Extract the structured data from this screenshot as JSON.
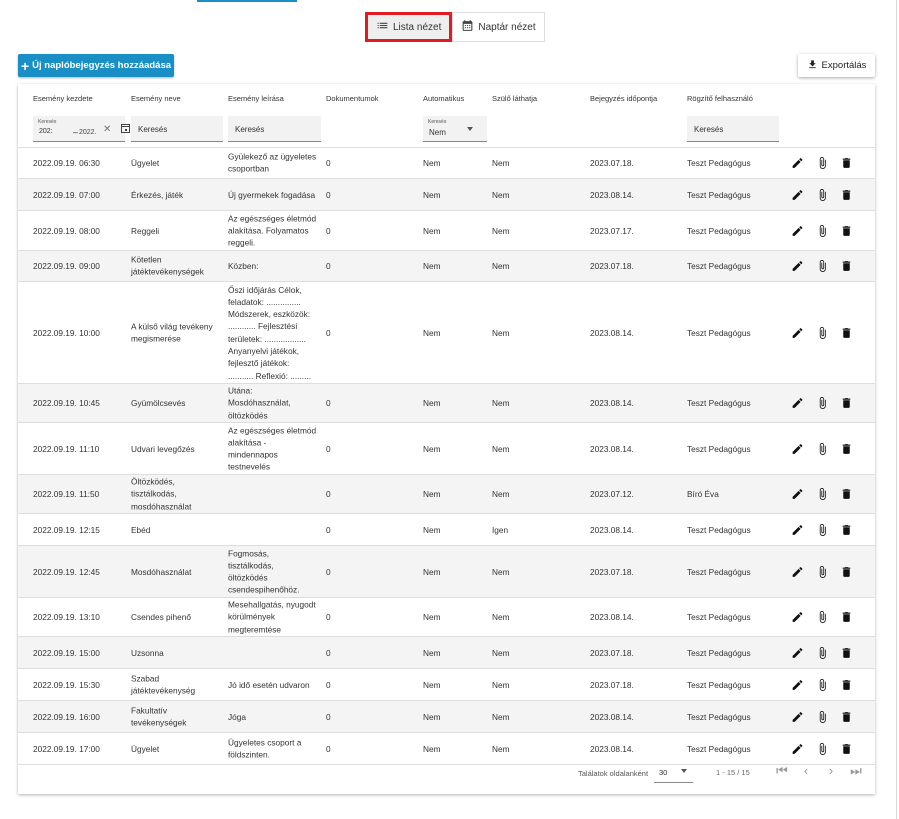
{
  "view_toggle": {
    "list_label": "Lista nézet",
    "calendar_label": "Naptár nézet"
  },
  "actions": {
    "add_label": "Új naplóbejegyzés hozzáadása",
    "export_label": "Exportálás"
  },
  "table": {
    "headers": [
      "Esemény kezdete",
      "Esemény neve",
      "Esemény leírása",
      "Dokumentumok",
      "Automatikus",
      "Szülő láthatja",
      "Bejegyzés időpontja",
      "Rögzítő felhasználó"
    ],
    "filters": {
      "date_from": "202:",
      "date_to": "2022.",
      "name_placeholder": "Keresés",
      "desc_placeholder": "Keresés",
      "auto_small_label": "Keresés",
      "auto_value": "Nem",
      "user_placeholder": "Keresés"
    },
    "rows": [
      {
        "start": "2022.09.19. 06:30",
        "name": [
          "Ügyelet"
        ],
        "desc": [
          "Gyülekező az ügyeletes",
          "csoportban"
        ],
        "docs": "0",
        "auto": "Nem",
        "parent": "Nem",
        "recorded": "2023.07.18.",
        "user": "Teszt Pedagógus"
      },
      {
        "start": "2022.09.19. 07:00",
        "name": [
          "Érkezés, játék"
        ],
        "desc": [
          "Új gyermekek fogadása"
        ],
        "docs": "0",
        "auto": "Nem",
        "parent": "Nem",
        "recorded": "2023.08.14.",
        "user": "Teszt Pedagógus"
      },
      {
        "start": "2022.09.19. 08:00",
        "name": [
          "Reggeli"
        ],
        "desc": [
          "Az egészséges életmód",
          "alakítása. Folyamatos",
          "reggeli."
        ],
        "docs": "0",
        "auto": "Nem",
        "parent": "Nem",
        "recorded": "2023.07.17.",
        "user": "Teszt Pedagógus"
      },
      {
        "start": "2022.09.19. 09:00",
        "name": [
          "Kötetlen",
          "játéktevékenységek"
        ],
        "desc": [
          "Közben:"
        ],
        "docs": "0",
        "auto": "Nem",
        "parent": "Nem",
        "recorded": "2023.07.18.",
        "user": "Teszt Pedagógus"
      },
      {
        "start": "2022.09.19. 10:00",
        "name": [
          "A külső világ tevékeny",
          "megismerése"
        ],
        "desc": [
          "Őszi időjárás Célok,",
          "feladatok: ...............",
          "Módszerek, eszközök:",
          "............ Fejlesztési",
          "területek: ..................",
          "Anyanyelvi játékok,",
          "fejlesztő játékok:",
          "........... Reflexió: ........."
        ],
        "docs": "0",
        "auto": "Nem",
        "parent": "Nem",
        "recorded": "2023.08.14.",
        "user": "Teszt Pedagógus"
      },
      {
        "start": "2022.09.19. 10:45",
        "name": [
          "Gyümölcsevés"
        ],
        "desc": [
          "Utána:",
          "Mosdóhasználat,",
          "öltözködés"
        ],
        "docs": "0",
        "auto": "Nem",
        "parent": "Nem",
        "recorded": "2023.08.14.",
        "user": "Teszt Pedagógus"
      },
      {
        "start": "2022.09.19. 11:10",
        "name": [
          "Udvari levegőzés"
        ],
        "desc": [
          "Az egészséges életmód",
          "alakítása -",
          "mindennapos",
          "testnevelés"
        ],
        "docs": "0",
        "auto": "Nem",
        "parent": "Nem",
        "recorded": "2023.08.14.",
        "user": "Teszt Pedagógus"
      },
      {
        "start": "2022.09.19. 11:50",
        "name": [
          "Öltözködés,",
          "tisztálkodás,",
          "mosdóhasználat"
        ],
        "desc": [],
        "docs": "0",
        "auto": "Nem",
        "parent": "Nem",
        "recorded": "2023.07.12.",
        "user": "Bíró Éva"
      },
      {
        "start": "2022.09.19. 12:15",
        "name": [
          "Ebéd"
        ],
        "desc": [],
        "docs": "0",
        "auto": "Nem",
        "parent": "Igen",
        "recorded": "2023.08.14.",
        "user": "Teszt Pedagógus"
      },
      {
        "start": "2022.09.19. 12:45",
        "name": [
          "Mosdóhasználat"
        ],
        "desc": [
          "Fogmosás,",
          "tisztálkodás,",
          "öltözködés",
          "csendespihenőhöz."
        ],
        "docs": "0",
        "auto": "Nem",
        "parent": "Nem",
        "recorded": "2023.07.18.",
        "user": "Teszt Pedagógus"
      },
      {
        "start": "2022.09.19. 13:10",
        "name": [
          "Csendes pihenő"
        ],
        "desc": [
          "Mesehallgatás, nyugodt",
          "körülmények",
          "megteremtése"
        ],
        "docs": "0",
        "auto": "Nem",
        "parent": "Nem",
        "recorded": "2023.08.14.",
        "user": "Teszt Pedagógus"
      },
      {
        "start": "2022.09.19. 15:00",
        "name": [
          "Uzsonna"
        ],
        "desc": [],
        "docs": "0",
        "auto": "Nem",
        "parent": "Nem",
        "recorded": "2023.07.18.",
        "user": "Teszt Pedagógus"
      },
      {
        "start": "2022.09.19. 15:30",
        "name": [
          "Szabad",
          "játéktevékenység"
        ],
        "desc": [
          "Jó idő esetén udvaron"
        ],
        "docs": "0",
        "auto": "Nem",
        "parent": "Nem",
        "recorded": "2023.07.18.",
        "user": "Teszt Pedagógus"
      },
      {
        "start": "2022.09.19. 16:00",
        "name": [
          "Fakultatív",
          "tevékenységek"
        ],
        "desc": [
          "Jóga"
        ],
        "docs": "0",
        "auto": "Nem",
        "parent": "Nem",
        "recorded": "2023.08.14.",
        "user": "Teszt Pedagógus"
      },
      {
        "start": "2022.09.19. 17:00",
        "name": [
          "Ügyelet"
        ],
        "desc": [
          "Ügyeletes csoport a",
          "földszinten."
        ],
        "docs": "0",
        "auto": "Nem",
        "parent": "Nem",
        "recorded": "2023.08.14.",
        "user": "Teszt Pedagógus"
      }
    ]
  },
  "pager": {
    "per_page_label": "Találatok oldalanként",
    "per_page_value": "30",
    "range": "1 - 15 / 15"
  }
}
